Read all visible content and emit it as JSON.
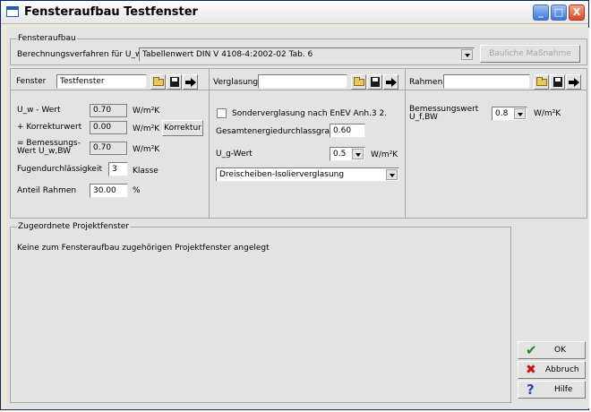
{
  "window": {
    "title": "Fensteraufbau Testfenster",
    "controls": [
      "_",
      "□",
      "X"
    ]
  },
  "top": {
    "group_label": "Fensteraufbau",
    "method_label": "Berechnungsverfahren für U_w",
    "method_value": "Tabellenwert DIN V 4108-4:2002-02 Tab. 6",
    "bauliche_button": "Bauliche Maßnahme"
  },
  "fenster": {
    "label": "Fenster",
    "name": "Testfenster",
    "uw_label": "U_w - Wert",
    "uw_value": "0.70",
    "uw_unit": "W/m²K",
    "korr_label": "+ Korrekturwert",
    "korr_value": "0.00",
    "korr_unit": "W/m²K",
    "korr_button": "Korrektur",
    "bem_label_1": "= Bemessungs-",
    "bem_label_2": "Wert U_w,BW",
    "bem_value": "0.70",
    "bem_unit": "W/m²K",
    "fug_label": "Fugendurchlässigkeit",
    "fug_value": "3",
    "fug_unit": "Klasse",
    "anteil_label": "Anteil Rahmen",
    "anteil_value": "30.00",
    "anteil_unit": "%"
  },
  "verglasung": {
    "label": "Verglasung",
    "name": "",
    "sonder_label": "Sonderverglasung nach EnEV Anh.3 2.",
    "g_label": "Gesamtenergiedurchlassgrad g",
    "g_value": "0.60",
    "ug_label": "U_g-Wert",
    "ug_value": "0.5",
    "ug_unit": "W/m²K",
    "type_value": "Dreischeiben-Isolierverglasung"
  },
  "rahmen": {
    "label": "Rahmen",
    "name": "",
    "bem_label_1": "Bemessungswert",
    "bem_label_2": "U_f,BW",
    "bem_value": "0.8",
    "bem_unit": "W/m²K"
  },
  "projekt": {
    "group_label": "Zugeordnete Projektfenster",
    "message": "Keine zum Fensteraufbau zugehörigen Projektfenster angelegt"
  },
  "actions": {
    "ok": "OK",
    "abbruch": "Abbruch",
    "hilfe": "Hilfe"
  },
  "colors": {
    "ok_icon": "#1e8a2a",
    "abbruch_icon": "#cc1111",
    "hilfe_icon": "#1a4fb0"
  }
}
